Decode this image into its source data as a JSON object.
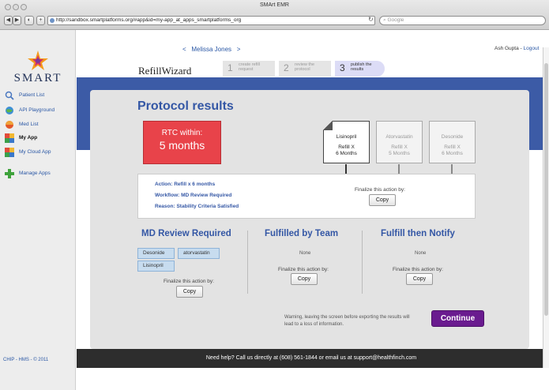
{
  "browser": {
    "title": "SMArt EMR",
    "url": "http://sandbox.smartplatforms.org/#app&id=my-app_at_apps_smartplatforms_org",
    "search_placeholder": "Google"
  },
  "sidebar": {
    "brand": "SMART",
    "items": [
      {
        "label": "Patient List",
        "icon": "magnifier-icon"
      },
      {
        "label": "API Playground",
        "icon": "globe-icon"
      },
      {
        "label": "Med List",
        "icon": "pills-icon"
      },
      {
        "label": "My App",
        "icon": "app-icon"
      },
      {
        "label": "My Cloud App",
        "icon": "cloud-app-icon"
      },
      {
        "label": "Manage Apps",
        "icon": "plus-icon"
      }
    ],
    "footer": "CHIP - HMS - © 2011"
  },
  "header": {
    "patient_name": "Melissa Jones",
    "prev": "<",
    "next": ">",
    "user": "Ash Gupta",
    "separator": " - ",
    "logout": "Logout",
    "brand": "RefillWizard",
    "steps": [
      {
        "num": "1",
        "label": "create refill request"
      },
      {
        "num": "2",
        "label": "review the protocol"
      },
      {
        "num": "3",
        "label": "publish the results"
      }
    ]
  },
  "main": {
    "title": "Protocol results",
    "rtc": {
      "line1": "RTC within:",
      "line2": "5 months"
    },
    "drugs": [
      {
        "name": "Lisinopril",
        "refill": "Refill X",
        "months": "6 Months"
      },
      {
        "name": "Atorvastatin",
        "refill": "Refill X",
        "months": "5 Months"
      },
      {
        "name": "Desonide",
        "refill": "Refill X",
        "months": "6 Months"
      }
    ],
    "details": {
      "action": "Action: Refill x 6 months",
      "workflow": "Workflow: MD Review Required",
      "reason": "Reason: Stability Criteria Satisfied",
      "finalize": "Finalize this action by:",
      "copy": "Copy"
    },
    "columns": [
      {
        "title": "MD Review Required",
        "tags": [
          "Desonide",
          "atorvastatin",
          "Lisinopril"
        ],
        "finalize": "Finalize this action by:",
        "copy": "Copy"
      },
      {
        "title": "Fulfilled by Team",
        "empty": "None",
        "finalize": "Finalize this action by:",
        "copy": "Copy"
      },
      {
        "title": "Fulfill then Notify",
        "empty": "None",
        "finalize": "Finalize this action by:",
        "copy": "Copy"
      }
    ],
    "warning": "Warning, leaving the screen before exporting the results will lead to a loss of information.",
    "continue": "Continue"
  },
  "footer": {
    "text": "Need help? Call us directly at (608) 561-1844 or email us at support@healthfinch.com"
  },
  "colors": {
    "accent_blue": "#3457a5",
    "band_blue": "#3c5ba6",
    "rtc_red": "#e8434a",
    "continue_purple": "#6a1b8f",
    "tag_blue": "#c7dcef"
  }
}
